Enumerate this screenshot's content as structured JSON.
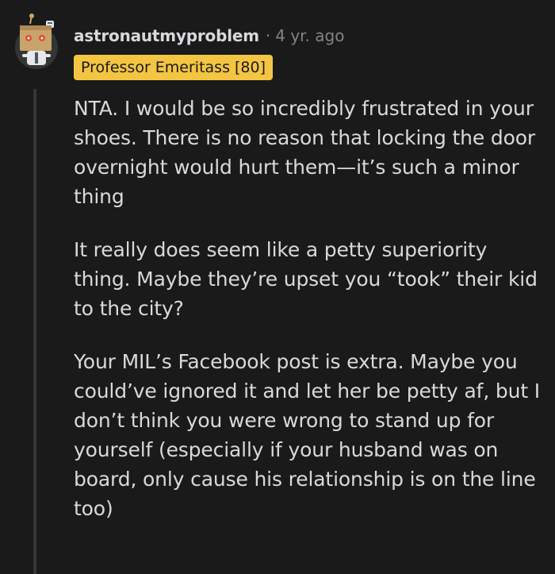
{
  "comment": {
    "username": "astronautmyproblem",
    "separator": "·",
    "timestamp": "4 yr. ago",
    "flair": "Professor Emeritass [80]",
    "avatar_icon": "snoo-box-head-avatar",
    "flair_color": "#f4c542",
    "paragraphs": [
      "NTA. I would be so incredibly frustrated in your shoes. There is no reason that locking the door overnight would hurt them—it’s such a minor thing",
      "It really does seem like a petty superiority thing. Maybe they’re upset you “took” their kid to the city?",
      "Your MIL’s Facebook post is extra. Maybe you could’ve ignored it and let her be petty af, but I don’t think you were wrong to stand up for yourself (especially if your husband was on board, only cause his relationship is on the line too)"
    ]
  }
}
